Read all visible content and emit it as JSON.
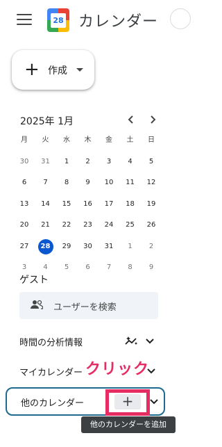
{
  "header": {
    "logo_number": "28",
    "title": "カレンダー",
    "logo_colors": [
      "#4285f4",
      "#34a853",
      "#fbbc04",
      "#ea4335"
    ]
  },
  "create": {
    "label": "作成",
    "plus_glyph": "+"
  },
  "mini_calendar": {
    "month_label": "2025年 1月",
    "prev_glyph": "‹",
    "next_glyph": "›",
    "weekdays": [
      "月",
      "火",
      "水",
      "木",
      "金",
      "土",
      "日"
    ],
    "weeks": [
      [
        "30",
        "31",
        "1",
        "2",
        "3",
        "4",
        "5"
      ],
      [
        "6",
        "7",
        "8",
        "9",
        "10",
        "11",
        "12"
      ],
      [
        "13",
        "14",
        "15",
        "16",
        "17",
        "18",
        "19"
      ],
      [
        "20",
        "21",
        "22",
        "23",
        "24",
        "25",
        "26"
      ],
      [
        "27",
        "28",
        "29",
        "30",
        "31",
        "1",
        "2"
      ],
      [
        "3",
        "4",
        "5",
        "6",
        "7",
        "8",
        "9"
      ]
    ],
    "today": "28",
    "accent_color": "#0b57d0"
  },
  "guest": {
    "title": "ゲスト",
    "search_placeholder": "ユーザーを検索"
  },
  "sections": {
    "insights": "時間の分析情報",
    "my_calendars": "マイカレンダー",
    "other_calendars": "他のカレンダー"
  },
  "add_button_glyph": "+",
  "annotation": {
    "click_label": "クリック",
    "color": "#e52d64"
  },
  "tooltip": "他のカレンダーを追加"
}
